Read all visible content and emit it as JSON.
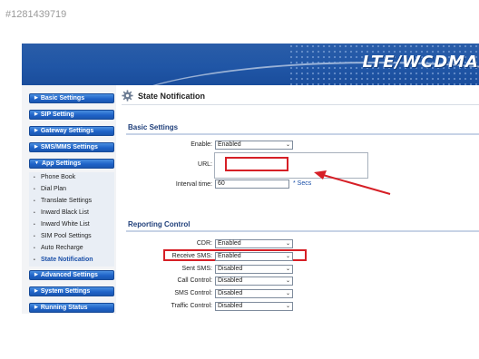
{
  "watermark": "#1281439719",
  "brand": "LTE/WCDMA",
  "sidebar": {
    "items": [
      {
        "label": "Basic Settings"
      },
      {
        "label": "SIP Setting"
      },
      {
        "label": "Gateway Settings"
      },
      {
        "label": "SMS/MMS Settings"
      },
      {
        "label": "App Settings"
      }
    ],
    "sub_items": [
      {
        "label": "Phone Book"
      },
      {
        "label": "Dial Plan"
      },
      {
        "label": "Translate Settings"
      },
      {
        "label": "Inward Black List"
      },
      {
        "label": "Inward White List"
      },
      {
        "label": "SIM Pool Settings"
      },
      {
        "label": "Auto Recharge"
      },
      {
        "label": "State Notification"
      }
    ],
    "items_bottom": [
      {
        "label": "Advanced Settings"
      },
      {
        "label": "System Settings"
      },
      {
        "label": "Running Status"
      }
    ]
  },
  "page": {
    "title": "State Notification",
    "basic_settings": {
      "heading": "Basic Settings",
      "enable_label": "Enable:",
      "enable_value": "Enabled",
      "url_label": "URL:",
      "url_value": "",
      "interval_label": "Interval time:",
      "interval_value": "60",
      "interval_unit": "* Secs"
    },
    "reporting_control": {
      "heading": "Reporting Control",
      "rows": [
        {
          "label": "CDR:",
          "value": "Enabled"
        },
        {
          "label": "Receive SMS:",
          "value": "Enabled"
        },
        {
          "label": "Sent SMS:",
          "value": "Disabled"
        },
        {
          "label": "Call Control:",
          "value": "Disabled"
        },
        {
          "label": "SMS Control:",
          "value": "Disabled"
        },
        {
          "label": "Traffic Control:",
          "value": "Disabled"
        }
      ]
    }
  },
  "colors": {
    "accent": "#1f63c8",
    "highlight": "#d61f26"
  }
}
